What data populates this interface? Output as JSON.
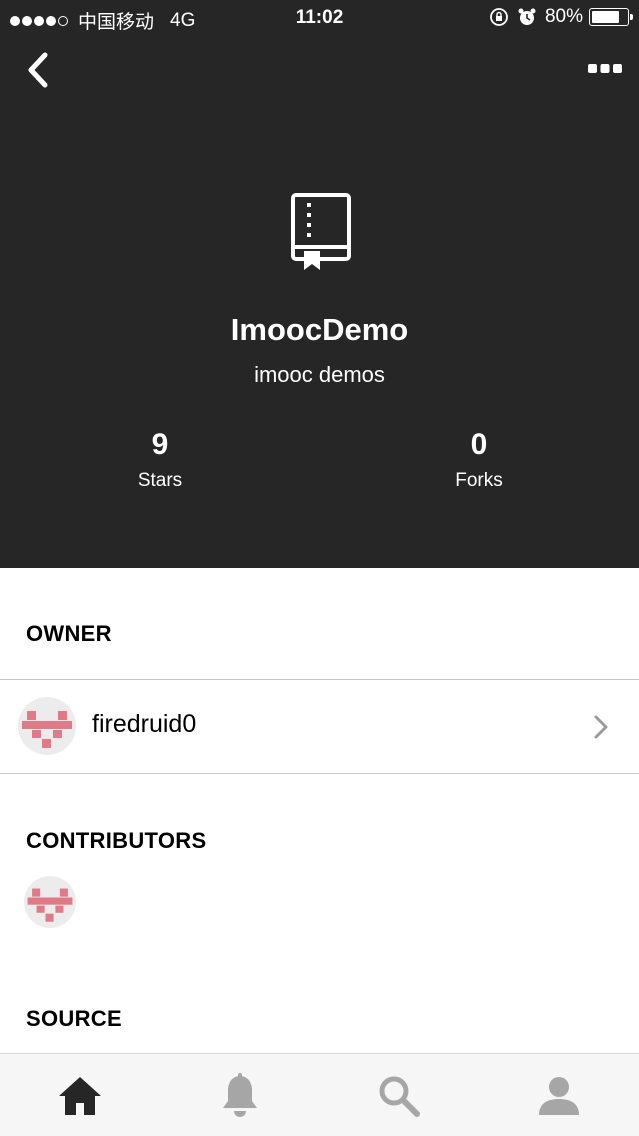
{
  "status_bar": {
    "carrier": "中国移动",
    "network": "4G",
    "time": "11:02",
    "battery": "80%",
    "battery_level": 0.8
  },
  "header": {
    "back_icon": "chevron-left-icon",
    "more_icon": "ellipsis-icon",
    "repo_icon": "repo-book-icon"
  },
  "repo": {
    "name": "ImoocDemo",
    "description": "imooc demos"
  },
  "stats": {
    "stars_value": "9",
    "stars_label": "Stars",
    "forks_value": "0",
    "forks_label": "Forks"
  },
  "owner": {
    "title": "OWNER",
    "username": "firedruid0"
  },
  "contributors": {
    "title": "CONTRIBUTORS"
  },
  "source": {
    "title": "SOURCE"
  },
  "tabbar": {
    "items": [
      "home-icon",
      "bell-icon",
      "search-icon",
      "user-icon"
    ]
  },
  "colors": {
    "header_bg": "#262626",
    "avatar_pink": "#e07a86",
    "tab_active": "#262626",
    "tab_inactive": "#a6a6a6"
  }
}
